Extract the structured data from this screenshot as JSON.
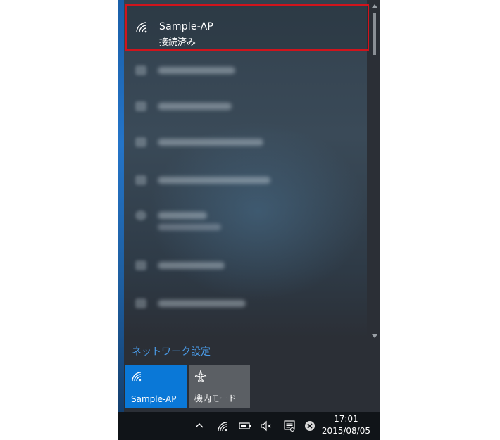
{
  "connected_network": {
    "name": "Sample-AP",
    "status": "接続済み",
    "icon": "wifi-signal-icon"
  },
  "settings_link": "ネットワーク設定",
  "quick_actions": [
    {
      "label": "Sample-AP",
      "icon": "wifi-icon",
      "state": "on",
      "color": "#0a78d7"
    },
    {
      "label": "機内モード",
      "icon": "airplane-icon",
      "state": "off",
      "color": "#5b5f64"
    }
  ],
  "taskbar": {
    "time": "17:01",
    "date": "2015/08/05",
    "icons": [
      "chevron-up-icon",
      "wifi-icon",
      "battery-icon",
      "speaker-muted-icon",
      "action-center-icon",
      "close-circle-icon"
    ]
  },
  "colors": {
    "accent": "#0a78d7",
    "link": "#4a9be8",
    "highlight_border": "#d0141c"
  }
}
